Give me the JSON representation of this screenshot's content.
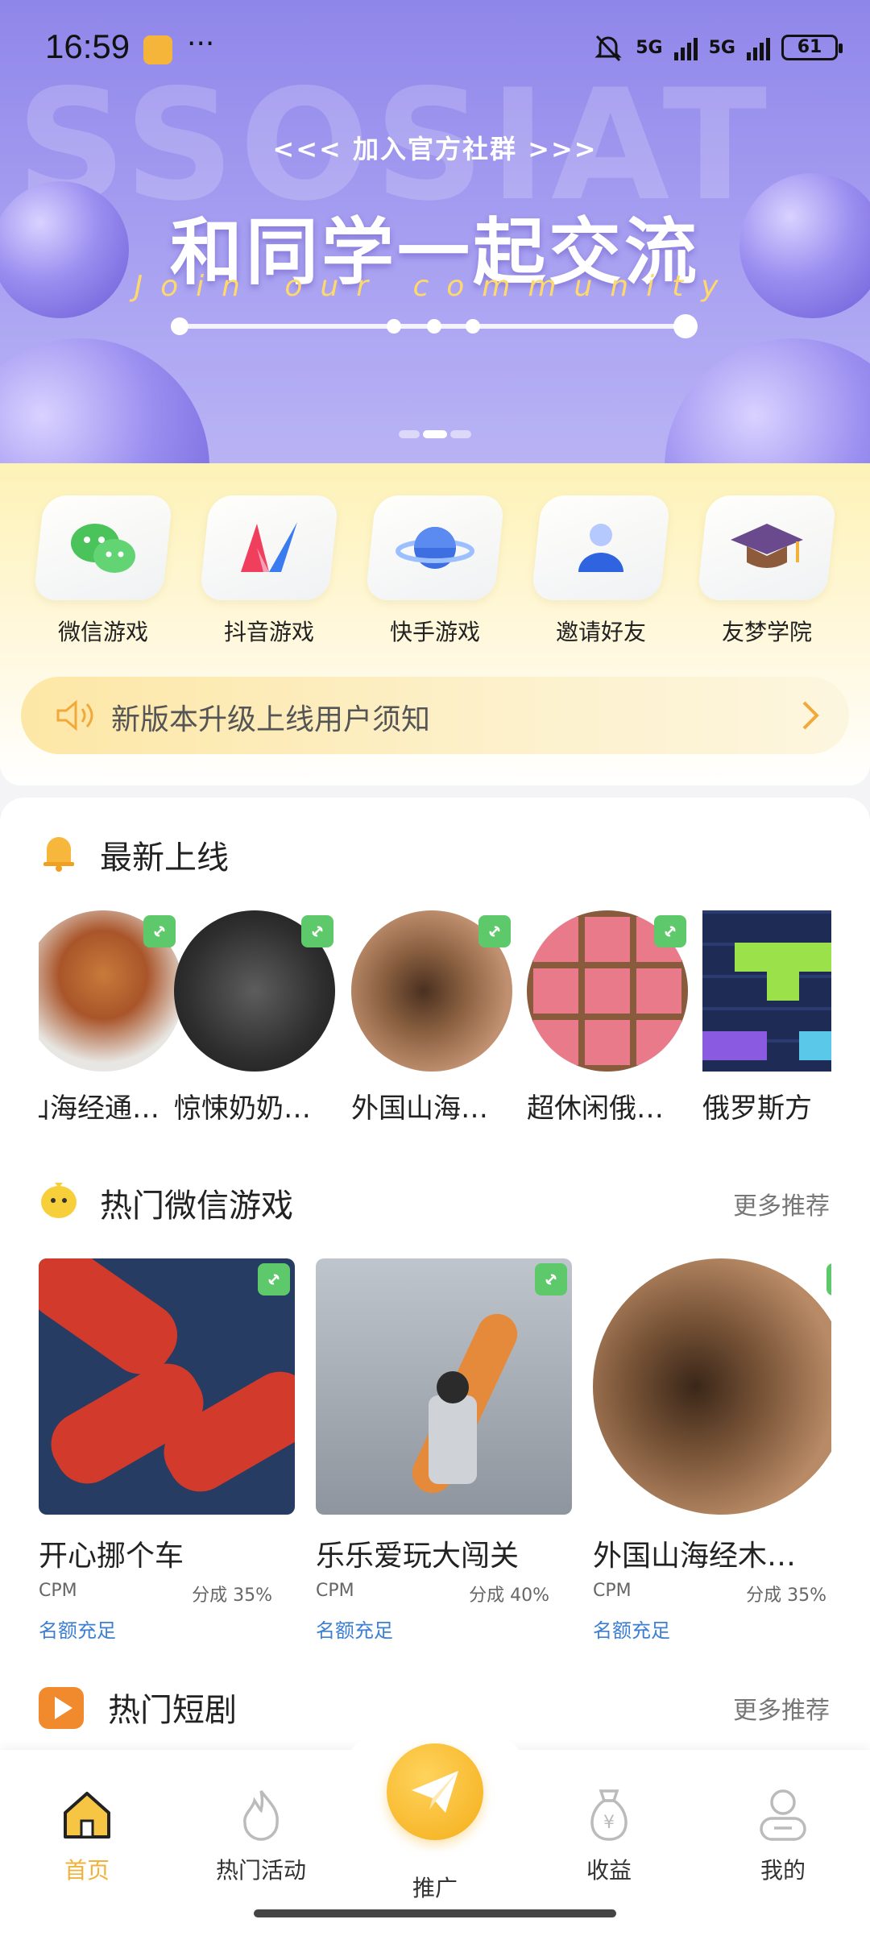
{
  "status_bar": {
    "time": "16:59",
    "signal1": "5G",
    "signal2": "5G",
    "battery": "61"
  },
  "banner": {
    "bg_text": "SSOSIAT",
    "subtitle": "<<< 加入官方社群 >>>",
    "headline": "和同学一起交流",
    "english": "Join our community"
  },
  "quick_menu": [
    {
      "label": "微信游戏",
      "icon": "wechat-icon"
    },
    {
      "label": "抖音游戏",
      "icon": "douyin-icon"
    },
    {
      "label": "快手游戏",
      "icon": "planet-icon"
    },
    {
      "label": "邀请好友",
      "icon": "user-icon"
    },
    {
      "label": "友梦学院",
      "icon": "graduation-cap-icon"
    }
  ],
  "notice": {
    "text": "新版本升级上线用户须知"
  },
  "new_online": {
    "title": "最新上线",
    "items": [
      {
        "name": "山海经通…"
      },
      {
        "name": "惊悚奶奶…"
      },
      {
        "name": "外国山海…"
      },
      {
        "name": "超休闲俄…"
      },
      {
        "name": "俄罗斯方"
      }
    ]
  },
  "hot_wechat": {
    "title": "热门微信游戏",
    "more": "更多推荐",
    "items": [
      {
        "name": "开心挪个车",
        "cpm": "CPM",
        "share": "分成 35%",
        "quota": "名额充足"
      },
      {
        "name": "乐乐爱玩大闯关",
        "cpm": "CPM",
        "share": "分成 40%",
        "quota": "名额充足"
      },
      {
        "name": "外国山海经木…",
        "cpm": "CPM",
        "share": "分成 35%",
        "quota": "名额充足"
      }
    ]
  },
  "hot_drama": {
    "title": "热门短剧",
    "more": "更多推荐"
  },
  "bottom_nav": [
    {
      "label": "首页"
    },
    {
      "label": "热门活动"
    },
    {
      "label": "推广"
    },
    {
      "label": "收益"
    },
    {
      "label": "我的"
    }
  ],
  "colors": {
    "accent": "#f1b23a",
    "link": "#3d7fd1",
    "banner": "#a49cf0"
  }
}
